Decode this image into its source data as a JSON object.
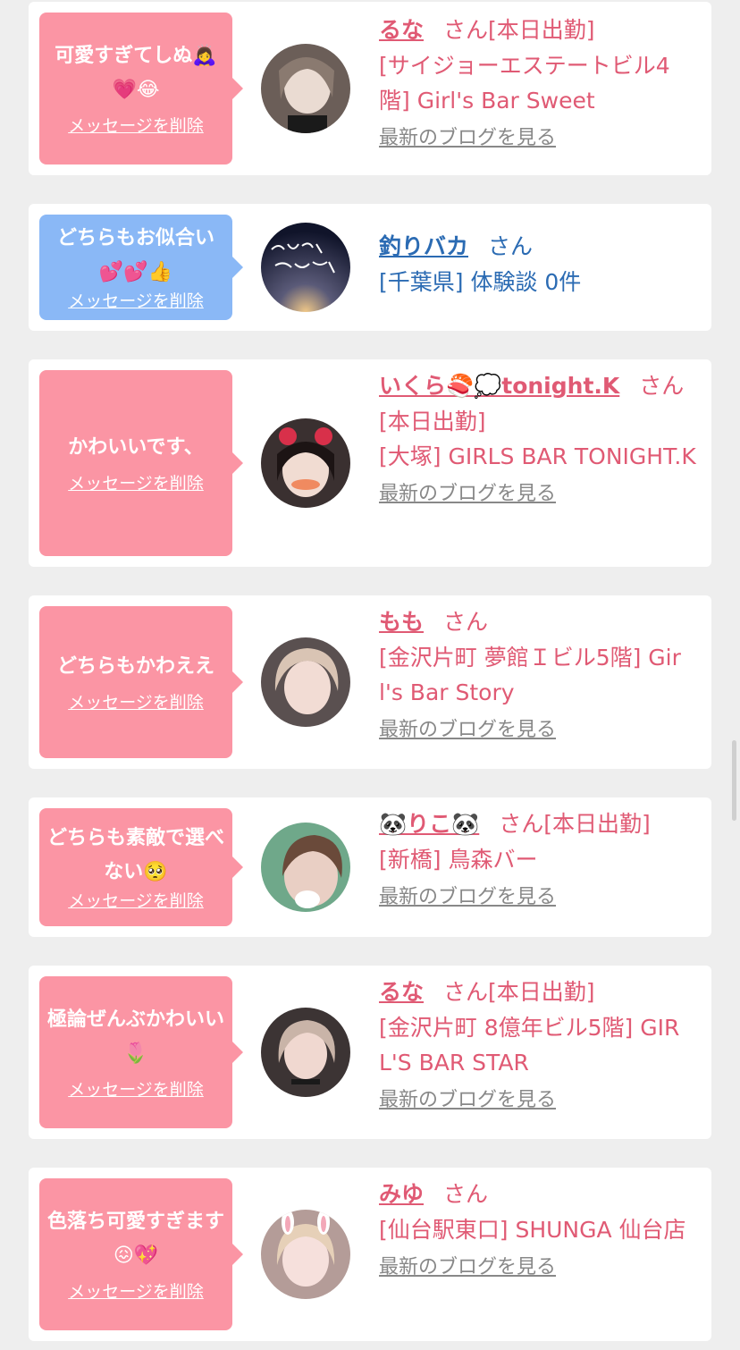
{
  "colors": {
    "bubble_pink": "#fb95a4",
    "bubble_blue": "#8ab8f6",
    "name_pink": "#e05a74",
    "name_blue": "#2b6bb3",
    "link_gray": "#888888"
  },
  "messages": [
    {
      "text": "可愛すぎてしぬ🙇‍♀️💗😂",
      "delete_label": "メッセージを削除",
      "name": "るな",
      "san": "さん[本日出勤]",
      "shop": "[サイジョーエステートビル4階] Girl's Bar Sweet",
      "blog_label": "最新のブログを見る"
    },
    {
      "text": "どちらもお似合い💕💕👍",
      "delete_label": "メッセージを削除",
      "name": "釣りバカ",
      "san": "さん",
      "shop": "[千葉県] 体験談 0件"
    },
    {
      "text": "かわいいです、",
      "delete_label": "メッセージを削除",
      "name": "いくら🍣💭tonight.K",
      "san": "さん",
      "status": "[本日出勤]",
      "shop": "[大塚] GIRLS BAR TONIGHT.K",
      "blog_label": "最新のブログを見る"
    },
    {
      "text": "どちらもかわええ",
      "delete_label": "メッセージを削除",
      "name": "もも",
      "san": "さん",
      "shop": "[金沢片町 夢館Ｉビル5階] Girl's Bar Story",
      "blog_label": "最新のブログを見る"
    },
    {
      "text": "どちらも素敵で選べない🥺",
      "delete_label": "メッセージを削除",
      "name": "🐼りこ🐼",
      "san": "さん[本日出勤]",
      "shop": "[新橋] 鳥森バー",
      "blog_label": "最新のブログを見る"
    },
    {
      "text": "極論ぜんぶかわいい🌷",
      "delete_label": "メッセージを削除",
      "name": "るな",
      "san": "さん[本日出勤]",
      "shop": "[金沢片町 8億年ビル5階] GIRL'S BAR STAR",
      "blog_label": "最新のブログを見る"
    },
    {
      "text": "色落ち可愛すぎます😖💖",
      "delete_label": "メッセージを削除",
      "name": "みゆ",
      "san": "さん",
      "shop": "[仙台駅東口] SHUNGA 仙台店",
      "blog_label": "最新のブログを見る"
    }
  ]
}
